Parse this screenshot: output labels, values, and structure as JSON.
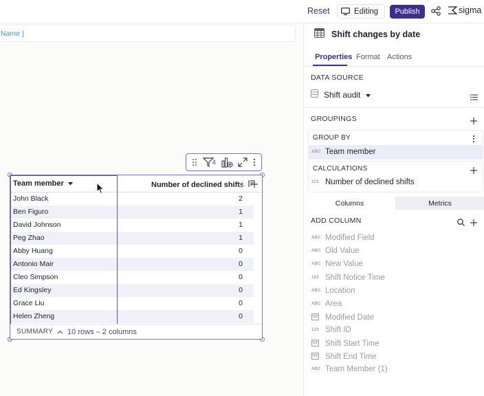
{
  "topbar": {
    "reset_label": "Reset",
    "editing_label": "Editing",
    "publish_label": "Publish",
    "logo_text": "sigma",
    "accent": "#3b2f8f"
  },
  "canvas": {
    "name_placeholder": "Name ]"
  },
  "table": {
    "columns": [
      "Team member",
      "Number of declined shifts"
    ],
    "rows": [
      {
        "name": "John Black",
        "value": "2"
      },
      {
        "name": "Ben Figuro",
        "value": "1"
      },
      {
        "name": "David Johnson",
        "value": "1"
      },
      {
        "name": "Peg Zhao",
        "value": "1"
      },
      {
        "name": "Abby Huang",
        "value": "0"
      },
      {
        "name": "Antonio Mair",
        "value": "0"
      },
      {
        "name": "Cleo Simpson",
        "value": "0"
      },
      {
        "name": "Ed Kingsley",
        "value": "0"
      },
      {
        "name": "Grace Liu",
        "value": "0"
      },
      {
        "name": "Helen Zheng",
        "value": "0"
      }
    ],
    "summary_label": "SUMMARY",
    "summary_info": "10 rows – 2 columns",
    "filter_count": "4"
  },
  "panel": {
    "title": "Shift changes by date",
    "tabs": [
      "Properties",
      "Format",
      "Actions"
    ],
    "data_source_label": "DATA SOURCE",
    "data_source_name": "Shift audit",
    "groupings_label": "GROUPINGS",
    "group_by_label": "GROUP BY",
    "group_by_item": "Team member",
    "calculations_label": "CALCULATIONS",
    "calculation_item": "Number of declined shifts",
    "segment": [
      "Columns",
      "Metrics"
    ],
    "add_column_label": "ADD COLUMN",
    "fields": [
      {
        "type": "ABC",
        "label": "Modified Field"
      },
      {
        "type": "ABC",
        "label": "Old Value"
      },
      {
        "type": "ABC",
        "label": "New Value"
      },
      {
        "type": "123",
        "label": "Shift Notice Time"
      },
      {
        "type": "ABC",
        "label": "Location"
      },
      {
        "type": "ABC",
        "label": "Area"
      },
      {
        "type": "date",
        "label": "Modified Date"
      },
      {
        "type": "123",
        "label": "Shift ID"
      },
      {
        "type": "date",
        "label": "Shift Start Time"
      },
      {
        "type": "date",
        "label": "Shift End Time"
      },
      {
        "type": "ABC",
        "label": "Team Member (1)"
      }
    ]
  }
}
